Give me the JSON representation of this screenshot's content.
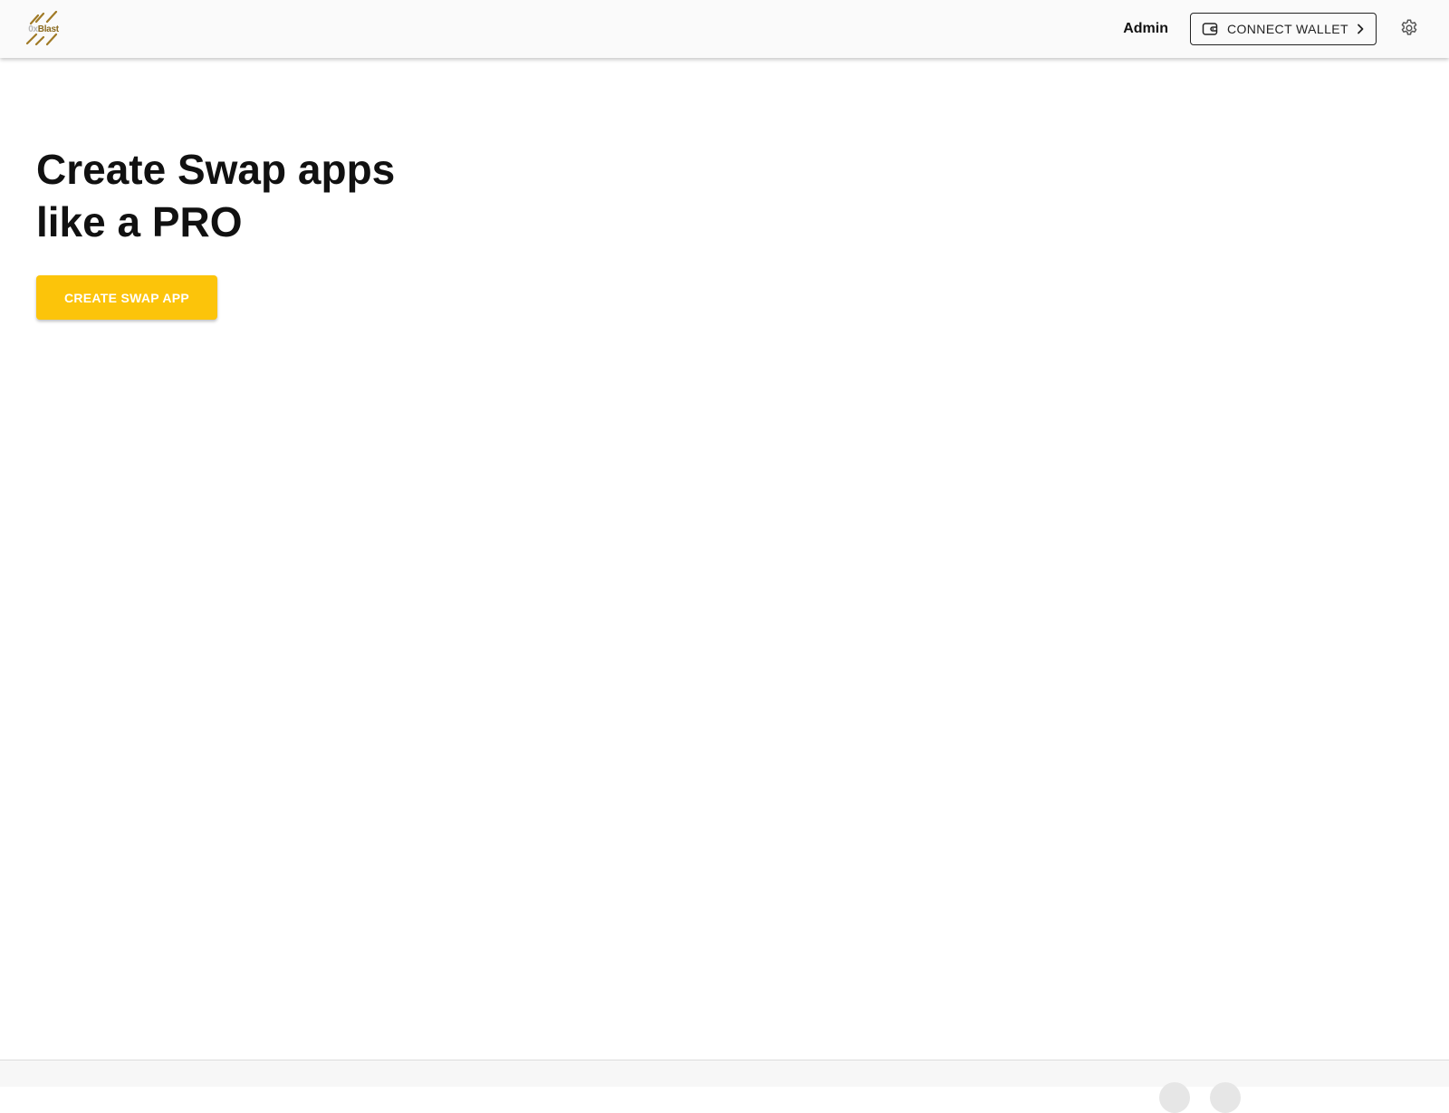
{
  "header": {
    "logo": {
      "icon": "blast-logo-icon",
      "text_part1": "0x",
      "text_part2": "Blast"
    },
    "admin_label": "Admin",
    "connect_wallet": {
      "label": "CONNECT WALLET",
      "icon": "wallet-icon",
      "trailing_icon": "chevron-right-icon"
    },
    "settings_icon": "gear-icon"
  },
  "hero": {
    "title_line1": "Create Swap apps",
    "title_line2": "like a PRO",
    "cta_label": "CREATE SWAP APP"
  },
  "colors": {
    "accent": "#fcc40a",
    "app_bar": "#fafafa",
    "text": "#111111",
    "logo_gold": "#8a6a1e"
  }
}
